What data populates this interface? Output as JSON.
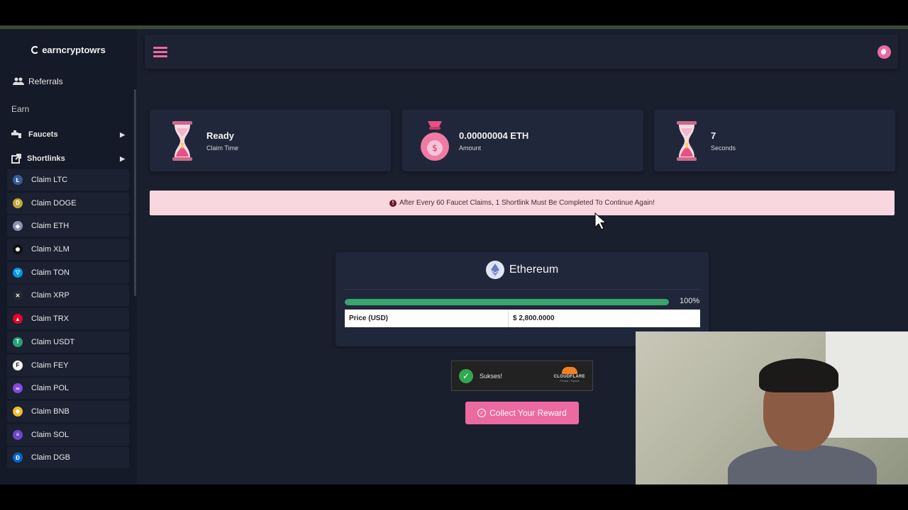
{
  "brand": {
    "name": "earncryptowrs"
  },
  "sidebar": {
    "referrals": "Referrals",
    "section": "Earn",
    "groups": [
      {
        "label": "Faucets"
      },
      {
        "label": "Shortlinks"
      }
    ],
    "claims": [
      {
        "label": "Claim LTC",
        "color": "#345d9d",
        "glyph": "Ł"
      },
      {
        "label": "Claim DOGE",
        "color": "#c2a633",
        "glyph": "D"
      },
      {
        "label": "Claim ETH",
        "color": "#8a92b2",
        "glyph": "◆"
      },
      {
        "label": "Claim XLM",
        "color": "#111111",
        "glyph": "✺"
      },
      {
        "label": "Claim TON",
        "color": "#0098ea",
        "glyph": "▽"
      },
      {
        "label": "Claim XRP",
        "color": "#23292f",
        "glyph": "✕"
      },
      {
        "label": "Claim TRX",
        "color": "#eb0029",
        "glyph": "▲"
      },
      {
        "label": "Claim USDT",
        "color": "#26a17b",
        "glyph": "T"
      },
      {
        "label": "Claim FEY",
        "color": "#f4f4f4",
        "glyph": "F"
      },
      {
        "label": "Claim POL",
        "color": "#8247e5",
        "glyph": "∞"
      },
      {
        "label": "Claim BNB",
        "color": "#f3ba2f",
        "glyph": "◈"
      },
      {
        "label": "Claim SOL",
        "color": "#6b47c9",
        "glyph": "≡"
      },
      {
        "label": "Claim DGB",
        "color": "#0066cc",
        "glyph": "Đ"
      }
    ]
  },
  "stats": [
    {
      "value": "Ready",
      "label": "Claim Time",
      "icon": "hourglass-icon"
    },
    {
      "value": "0.00000004 ETH",
      "label": "Amount",
      "icon": "money-bag-icon"
    },
    {
      "value": "7",
      "label": "Seconds",
      "icon": "hourglass-icon"
    }
  ],
  "alert": {
    "text": "After Every 60 Faucet Claims, 1 Shortlink Must Be Completed To Continue Again!"
  },
  "coin_panel": {
    "name": "Ethereum",
    "progress": 100,
    "progress_label": "100%",
    "price_key": "Price (USD)",
    "price_value": "$ 2,800.0000"
  },
  "captcha": {
    "status": "Sukses!",
    "brand": "CLOUDFLARE",
    "links": "Privasi • Syarat"
  },
  "actions": {
    "collect_label": "Collect Your Reward"
  },
  "colors": {
    "accent": "#ec6aa0",
    "success": "#3aa56b",
    "alert_bg": "#f8d7df",
    "bg": "#1a1f2e"
  }
}
